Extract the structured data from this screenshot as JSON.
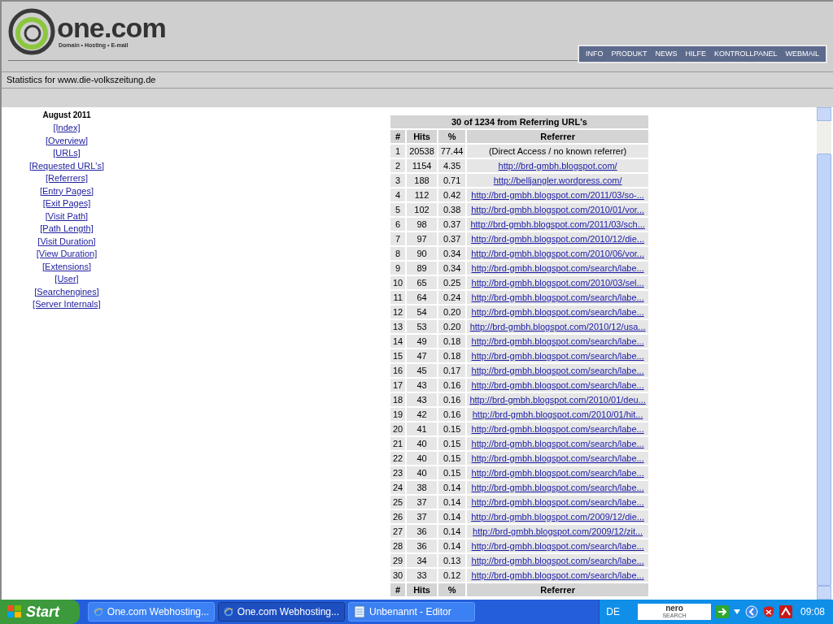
{
  "header": {
    "logo": {
      "name": "one.com",
      "tagline": "Domain • Hosting • E-mail"
    },
    "nav": [
      "INFO",
      "PRODUKT",
      "NEWS",
      "HILFE",
      "KONTROLLPANEL",
      "WEBMAIL"
    ]
  },
  "stats_bar": "Statistics for www.die-volkszeitung.de",
  "sidebar": {
    "title": "August 2011",
    "links": [
      "[Index]",
      "[Overview]",
      "[URLs]",
      "[Requested URL's]",
      "[Referrers]",
      "[Entry Pages]",
      "[Exit Pages]",
      "[Visit Path]",
      "[Path Length]",
      "[Visit Duration]",
      "[View Duration]",
      "[Extensions]",
      "[User]",
      "[Searchengines]",
      "[Server Internals]"
    ]
  },
  "table": {
    "title": "30 of 1234 from Referring URL's",
    "columns": [
      "#",
      "Hits",
      "%",
      "Referrer"
    ],
    "rows": [
      {
        "n": "1",
        "hits": "20538",
        "pct": "77.44",
        "referrer": "(Direct Access / no known referrer)",
        "kind": "text"
      },
      {
        "n": "2",
        "hits": "1154",
        "pct": "4.35",
        "referrer": "http://brd-gmbh.blogspot.com/",
        "kind": "link"
      },
      {
        "n": "3",
        "hits": "188",
        "pct": "0.71",
        "referrer": "http://belljangler.wordpress.com/",
        "kind": "link"
      },
      {
        "n": "4",
        "hits": "112",
        "pct": "0.42",
        "referrer": "http://brd-gmbh.blogspot.com/2011/03/so-...",
        "kind": "link"
      },
      {
        "n": "5",
        "hits": "102",
        "pct": "0.38",
        "referrer": "http://brd-gmbh.blogspot.com/2010/01/vor...",
        "kind": "link"
      },
      {
        "n": "6",
        "hits": "98",
        "pct": "0.37",
        "referrer": "http://brd-gmbh.blogspot.com/2011/03/sch...",
        "kind": "link"
      },
      {
        "n": "7",
        "hits": "97",
        "pct": "0.37",
        "referrer": "http://brd-gmbh.blogspot.com/2010/12/die...",
        "kind": "link"
      },
      {
        "n": "8",
        "hits": "90",
        "pct": "0.34",
        "referrer": "http://brd-gmbh.blogspot.com/2010/06/vor...",
        "kind": "link"
      },
      {
        "n": "9",
        "hits": "89",
        "pct": "0.34",
        "referrer": "http://brd-gmbh.blogspot.com/search/labe...",
        "kind": "link"
      },
      {
        "n": "10",
        "hits": "65",
        "pct": "0.25",
        "referrer": "http://brd-gmbh.blogspot.com/2010/03/sel...",
        "kind": "link"
      },
      {
        "n": "11",
        "hits": "64",
        "pct": "0.24",
        "referrer": "http://brd-gmbh.blogspot.com/search/labe...",
        "kind": "link"
      },
      {
        "n": "12",
        "hits": "54",
        "pct": "0.20",
        "referrer": "http://brd-gmbh.blogspot.com/search/labe...",
        "kind": "link"
      },
      {
        "n": "13",
        "hits": "53",
        "pct": "0.20",
        "referrer": "http://brd-gmbh.blogspot.com/2010/12/usa...",
        "kind": "link"
      },
      {
        "n": "14",
        "hits": "49",
        "pct": "0.18",
        "referrer": "http://brd-gmbh.blogspot.com/search/labe...",
        "kind": "link"
      },
      {
        "n": "15",
        "hits": "47",
        "pct": "0.18",
        "referrer": "http://brd-gmbh.blogspot.com/search/labe...",
        "kind": "link"
      },
      {
        "n": "16",
        "hits": "45",
        "pct": "0.17",
        "referrer": "http://brd-gmbh.blogspot.com/search/labe...",
        "kind": "link"
      },
      {
        "n": "17",
        "hits": "43",
        "pct": "0.16",
        "referrer": "http://brd-gmbh.blogspot.com/search/labe...",
        "kind": "link"
      },
      {
        "n": "18",
        "hits": "43",
        "pct": "0.16",
        "referrer": "http://brd-gmbh.blogspot.com/2010/01/deu...",
        "kind": "link"
      },
      {
        "n": "19",
        "hits": "42",
        "pct": "0.16",
        "referrer": "http://brd-gmbh.blogspot.com/2010/01/hit...",
        "kind": "link"
      },
      {
        "n": "20",
        "hits": "41",
        "pct": "0.15",
        "referrer": "http://brd-gmbh.blogspot.com/search/labe...",
        "kind": "link"
      },
      {
        "n": "21",
        "hits": "40",
        "pct": "0.15",
        "referrer": "http://brd-gmbh.blogspot.com/search/labe...",
        "kind": "link"
      },
      {
        "n": "22",
        "hits": "40",
        "pct": "0.15",
        "referrer": "http://brd-gmbh.blogspot.com/search/labe...",
        "kind": "link"
      },
      {
        "n": "23",
        "hits": "40",
        "pct": "0.15",
        "referrer": "http://brd-gmbh.blogspot.com/search/labe...",
        "kind": "link"
      },
      {
        "n": "24",
        "hits": "38",
        "pct": "0.14",
        "referrer": "http://brd-gmbh.blogspot.com/search/labe...",
        "kind": "link"
      },
      {
        "n": "25",
        "hits": "37",
        "pct": "0.14",
        "referrer": "http://brd-gmbh.blogspot.com/search/labe...",
        "kind": "link"
      },
      {
        "n": "26",
        "hits": "37",
        "pct": "0.14",
        "referrer": "http://brd-gmbh.blogspot.com/2009/12/die...",
        "kind": "link"
      },
      {
        "n": "27",
        "hits": "36",
        "pct": "0.14",
        "referrer": "http://brd-gmbh.blogspot.com/2009/12/zit...",
        "kind": "link"
      },
      {
        "n": "28",
        "hits": "36",
        "pct": "0.14",
        "referrer": "http://brd-gmbh.blogspot.com/search/labe...",
        "kind": "link"
      },
      {
        "n": "29",
        "hits": "34",
        "pct": "0.13",
        "referrer": "http://brd-gmbh.blogspot.com/search/labe...",
        "kind": "link"
      },
      {
        "n": "30",
        "hits": "33",
        "pct": "0.12",
        "referrer": "http://brd-gmbh.blogspot.com/search/labe...",
        "kind": "link"
      }
    ],
    "footer": [
      "#",
      "Hits",
      "%",
      "Referrer"
    ]
  },
  "taskbar": {
    "start": "Start",
    "tasks": [
      {
        "label": "One.com Webhosting...",
        "kind": "browser",
        "selected": false
      },
      {
        "label": "One.com Webhosting...",
        "kind": "browser",
        "selected": true
      },
      {
        "label": "Unbenannt - Editor",
        "kind": "notepad",
        "selected": false
      }
    ],
    "language": "DE",
    "search_logo": [
      "nero",
      "SEARCH"
    ],
    "clock": "09:08"
  }
}
